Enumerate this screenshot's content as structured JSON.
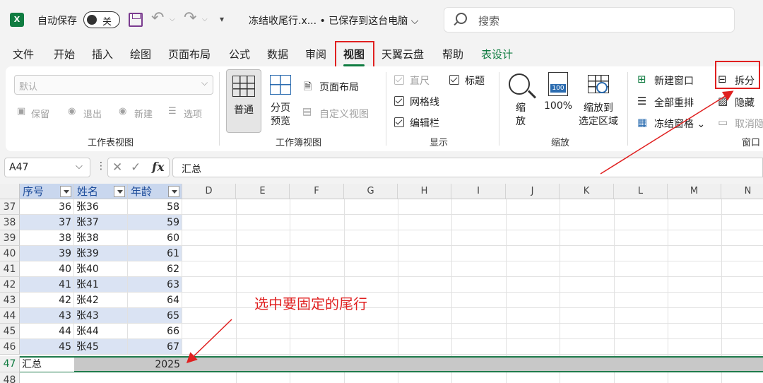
{
  "titlebar": {
    "autosave_label": "自动保存",
    "autosave_toggle": "关",
    "filename": "冻结收尾行.x... • 已保存到这台电脑 ⌵",
    "search_placeholder": "搜索"
  },
  "tabs": [
    "文件",
    "开始",
    "插入",
    "绘图",
    "页面布局",
    "公式",
    "数据",
    "审阅",
    "视图",
    "天翼云盘",
    "帮助",
    "表设计"
  ],
  "active_tab": "视图",
  "ribbon": {
    "sheet_view": {
      "dropdown_value": "默认",
      "buttons": [
        "保留",
        "退出",
        "新建",
        "选项"
      ],
      "label": "工作表视图"
    },
    "workbook_view": {
      "normal": "普通",
      "page_break_1": "分页",
      "page_break_2": "预览",
      "page_layout": "页面布局",
      "custom_views": "自定义视图",
      "label": "工作簿视图"
    },
    "show": {
      "ruler": "直尺",
      "gridlines": "网格线",
      "formula_bar": "编辑栏",
      "headings": "标题",
      "label": "显示"
    },
    "zoom": {
      "zoom_1": "缩",
      "zoom_2": "放",
      "hundred": "100%",
      "hundred_icon": "100",
      "zoom_sel_1": "缩放到",
      "zoom_sel_2": "选定区域",
      "label": "缩放"
    },
    "window": {
      "new_window": "新建窗口",
      "arrange_all": "全部重排",
      "freeze_panes": "冻结窗格 ⌄",
      "split": "拆分",
      "hide": "隐藏",
      "unhide": "取消隐",
      "label": "窗口"
    }
  },
  "formula_bar": {
    "name_box": "A47",
    "formula": "汇总",
    "fx": "fx"
  },
  "sheet": {
    "table_headers": [
      "序号",
      "姓名",
      "年龄"
    ],
    "columns": [
      "D",
      "E",
      "F",
      "G",
      "H",
      "I",
      "J",
      "K",
      "L",
      "M",
      "N"
    ],
    "rows": [
      {
        "row": "37",
        "a": "36",
        "b": "张36",
        "c": "58"
      },
      {
        "row": "38",
        "a": "37",
        "b": "张37",
        "c": "59"
      },
      {
        "row": "39",
        "a": "38",
        "b": "张38",
        "c": "60"
      },
      {
        "row": "40",
        "a": "39",
        "b": "张39",
        "c": "61"
      },
      {
        "row": "41",
        "a": "40",
        "b": "张40",
        "c": "62"
      },
      {
        "row": "42",
        "a": "41",
        "b": "张41",
        "c": "63"
      },
      {
        "row": "43",
        "a": "42",
        "b": "张42",
        "c": "64"
      },
      {
        "row": "44",
        "a": "43",
        "b": "张43",
        "c": "65"
      },
      {
        "row": "45",
        "a": "44",
        "b": "张44",
        "c": "66"
      },
      {
        "row": "46",
        "a": "45",
        "b": "张45",
        "c": "67"
      }
    ],
    "total_row": {
      "row": "47",
      "a": "汇总",
      "c": "2025"
    },
    "next_row": "48"
  },
  "annotation": "选中要固定的尾行",
  "colors": {
    "accent": "#107c41",
    "highlight_box": "#e02020",
    "table_band": "#dae3f3"
  }
}
